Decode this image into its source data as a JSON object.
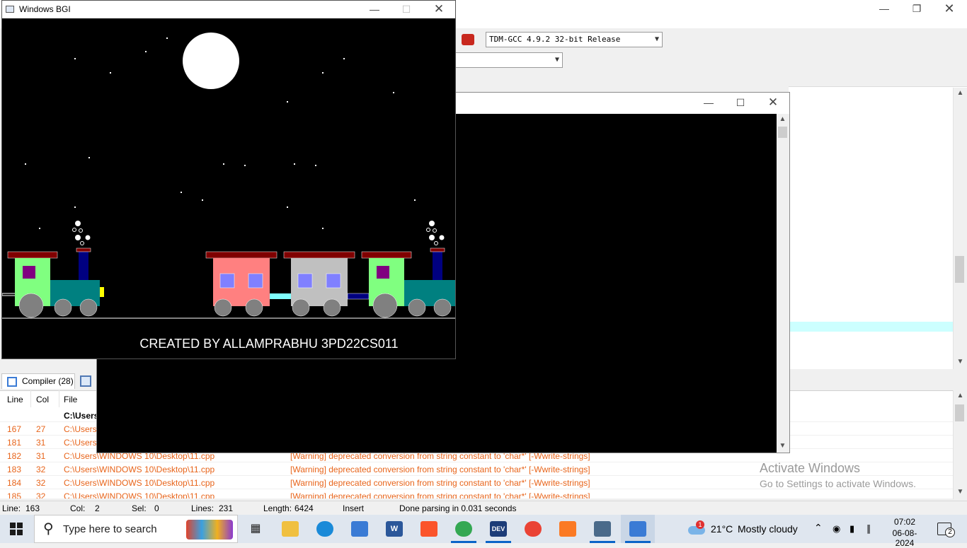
{
  "bgi_window": {
    "title": "Windows BGI",
    "credit_text": "CREATED BY ALLAMPRABHU 3PD22CS011"
  },
  "ide": {
    "compiler_combo": "TDM-GCC 4.9.2 32-bit Release",
    "compiler_tab_label": "Compiler (28)",
    "columns": {
      "line": "Line",
      "col": "Col",
      "file": "File"
    },
    "messages": [
      {
        "line": "",
        "col": "",
        "file": "C:\\Users\\",
        "message": ""
      },
      {
        "line": "167",
        "col": "27",
        "file": "C:\\Users\\",
        "message": ""
      },
      {
        "line": "181",
        "col": "31",
        "file": "C:\\Users\\",
        "message": ""
      },
      {
        "line": "182",
        "col": "31",
        "file": "C:\\Users\\WINDOWS 10\\Desktop\\11.cpp",
        "message": "[Warning] deprecated conversion from string constant to 'char*' [-Wwrite-strings]"
      },
      {
        "line": "183",
        "col": "32",
        "file": "C:\\Users\\WINDOWS 10\\Desktop\\11.cpp",
        "message": "[Warning] deprecated conversion from string constant to 'char*' [-Wwrite-strings]"
      },
      {
        "line": "184",
        "col": "32",
        "file": "C:\\Users\\WINDOWS 10\\Desktop\\11.cpp",
        "message": "[Warning] deprecated conversion from string constant to 'char*' [-Wwrite-strings]"
      },
      {
        "line": "185",
        "col": "32",
        "file": "C:\\Users\\WINDOWS 10\\Desktop\\11.cpp",
        "message": "[Warning] deprecated conversion from string constant to 'char*' [-Wwrite-strings]"
      }
    ],
    "status": {
      "line_label": "Line:",
      "line_value": "163",
      "col_label": "Col:",
      "col_value": "2",
      "sel_label": "Sel:",
      "sel_value": "0",
      "lines_label": "Lines:",
      "lines_value": "231",
      "length_label": "Length:",
      "length_value": "6424",
      "mode": "Insert",
      "message": "Done parsing in 0.031 seconds"
    }
  },
  "activation": {
    "title": "Activate Windows",
    "subtitle": "Go to Settings to activate Windows."
  },
  "taskbar": {
    "search_placeholder": "Type here to search",
    "weather_temp": "21°C",
    "weather_desc": "Mostly cloudy",
    "weather_badge": "1",
    "time": "07:02",
    "date": "06-08-2024",
    "notifications": "2",
    "apps": [
      "task-view",
      "file-explorer",
      "edge",
      "store",
      "word",
      "brave",
      "chrome-profile",
      "dev-cpp",
      "chrome",
      "xampp",
      "app-window",
      "bgi-window"
    ]
  },
  "colors": {
    "warning_text": "#e8641a",
    "highlight_line": "#ccffff",
    "taskbar": "#dfe6ef"
  }
}
